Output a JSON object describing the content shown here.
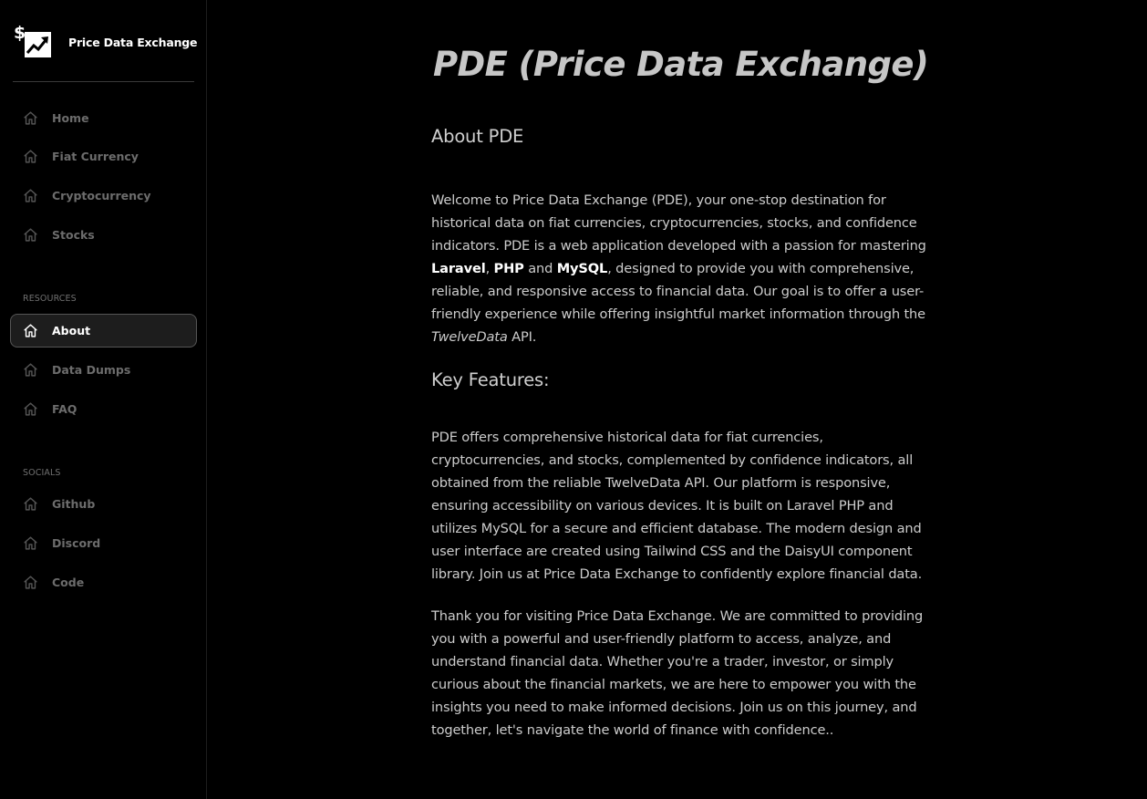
{
  "brand": {
    "title": "Price Data Exchange",
    "logo_icon": "dollar-chart-up-icon"
  },
  "sidebar": {
    "main_items": [
      {
        "label": "Home",
        "icon": "home-icon"
      },
      {
        "label": "Fiat Currency",
        "icon": "home-icon"
      },
      {
        "label": "Cryptocurrency",
        "icon": "home-icon"
      },
      {
        "label": "Stocks",
        "icon": "home-icon"
      }
    ],
    "resources_label": "RESOURCES",
    "resources_items": [
      {
        "label": "About",
        "icon": "home-icon",
        "active": true
      },
      {
        "label": "Data Dumps",
        "icon": "home-icon"
      },
      {
        "label": "FAQ",
        "icon": "home-icon"
      }
    ],
    "socials_label": "SOCIALS",
    "socials_items": [
      {
        "label": "Github",
        "icon": "home-icon"
      },
      {
        "label": "Discord",
        "icon": "home-icon"
      },
      {
        "label": "Code",
        "icon": "home-icon"
      }
    ]
  },
  "main": {
    "title": "PDE (Price Data Exchange)",
    "about_heading": "About PDE",
    "about": {
      "intro": "Welcome to Price Data Exchange (PDE), your one-stop destination for historical data on fiat currencies, cryptocurrencies, stocks, and confidence indicators. PDE is a web application developed with a passion for mastering ",
      "laravel": "Laravel",
      "sep1": ", ",
      "php": "PHP",
      "and": " and ",
      "mysql": "MySQL",
      "middle": ", designed to provide you with comprehensive, reliable, and responsive access to financial data. Our goal is to offer a user-friendly experience while offering insightful market information through the ",
      "twelvedata": "TwelveData",
      "end": " API."
    },
    "features_heading": "Key Features:",
    "features_text": "PDE offers comprehensive historical data for fiat currencies, cryptocurrencies, and stocks, complemented by confidence indicators, all obtained from the reliable TwelveData API. Our platform is responsive, ensuring accessibility on various devices. It is built on Laravel PHP and utilizes MySQL for a secure and efficient database. The modern design and user interface are created using Tailwind CSS and the DaisyUI component library. Join us at Price Data Exchange to confidently explore financial data.",
    "thanks_text": "Thank you for visiting Price Data Exchange. We are committed to providing you with a powerful and user-friendly platform to access, analyze, and understand financial data. Whether you're a trader, investor, or simply curious about the financial markets, we are here to empower you with the insights you need to make informed decisions. Join us on this journey, and together, let's navigate the world of finance with confidence.."
  },
  "colors": {
    "background": "#000000",
    "sidebar_active_bg": "#1d1d1d",
    "text_muted": "#6c6c6c",
    "text_body": "#cccccc",
    "title": "#c6c6c6"
  }
}
